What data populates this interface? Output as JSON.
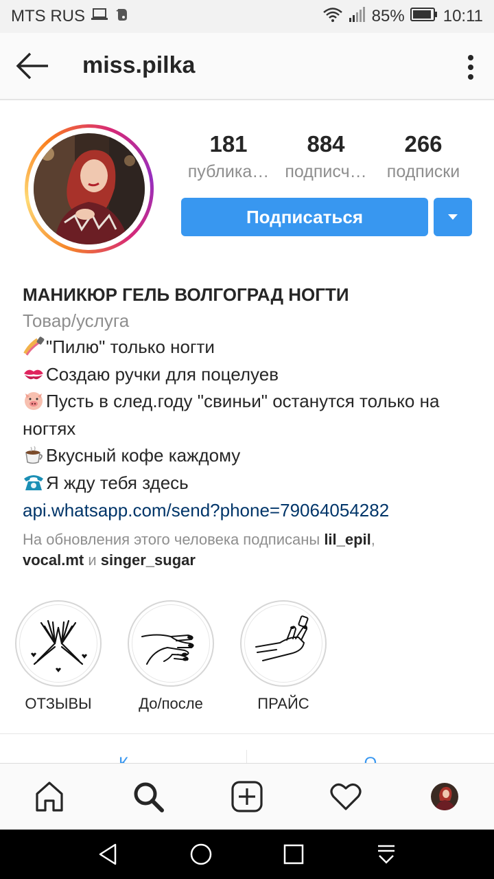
{
  "status_bar": {
    "carrier": "MTS RUS",
    "battery_percent": "85%",
    "time": "10:11"
  },
  "app_bar": {
    "username": "miss.pilka"
  },
  "stats": [
    {
      "value": "181",
      "label": "публика…"
    },
    {
      "value": "884",
      "label": "подписч…"
    },
    {
      "value": "266",
      "label": "подписки"
    }
  ],
  "actions": {
    "follow_label": "Подписаться"
  },
  "bio": {
    "name": "МАНИКЮР ГЕЛЬ ВОЛГОГРАД НОГТИ",
    "category": "Товар/услуга",
    "lines": [
      {
        "emoji": "nail-polish-icon",
        "text": "\"Пилю\" только ногти"
      },
      {
        "emoji": "kiss-mark-icon",
        "text": "Создаю ручки для поцелуев"
      },
      {
        "emoji": "pig-face-icon",
        "text": "Пусть в след.году \"свиньи\" останутся только на ногтях"
      },
      {
        "emoji": "coffee-icon",
        "text": "Вкусный кофе каждому"
      },
      {
        "emoji": "telephone-icon",
        "text": "Я жду тебя здесь"
      }
    ],
    "link": "api.whatsapp.com/send?phone=79064054282",
    "followed_by_prefix": "На обновления этого человека подписаны ",
    "followed_by_user1": "lil_epil",
    "followed_by_sep": ",",
    "followed_by_user2": "vocal.mt",
    "followed_by_and": " и ",
    "followed_by_user3": "singer_sugar"
  },
  "highlights": [
    {
      "label": "ОТЗЫВЫ",
      "icon": "hands-hearts-icon"
    },
    {
      "label": "До/после",
      "icon": "manicure-hands-icon"
    },
    {
      "label": "ПРАЙС",
      "icon": "hand-polish-icon"
    }
  ],
  "tabs_peek": [
    "К",
    "О"
  ],
  "bottom_nav": [
    "home-icon",
    "search-icon",
    "add-post-icon",
    "heart-icon",
    "profile-avatar"
  ],
  "colors": {
    "accent": "#3897f0",
    "link": "#003569",
    "secondary_text": "#8e8e8e"
  }
}
